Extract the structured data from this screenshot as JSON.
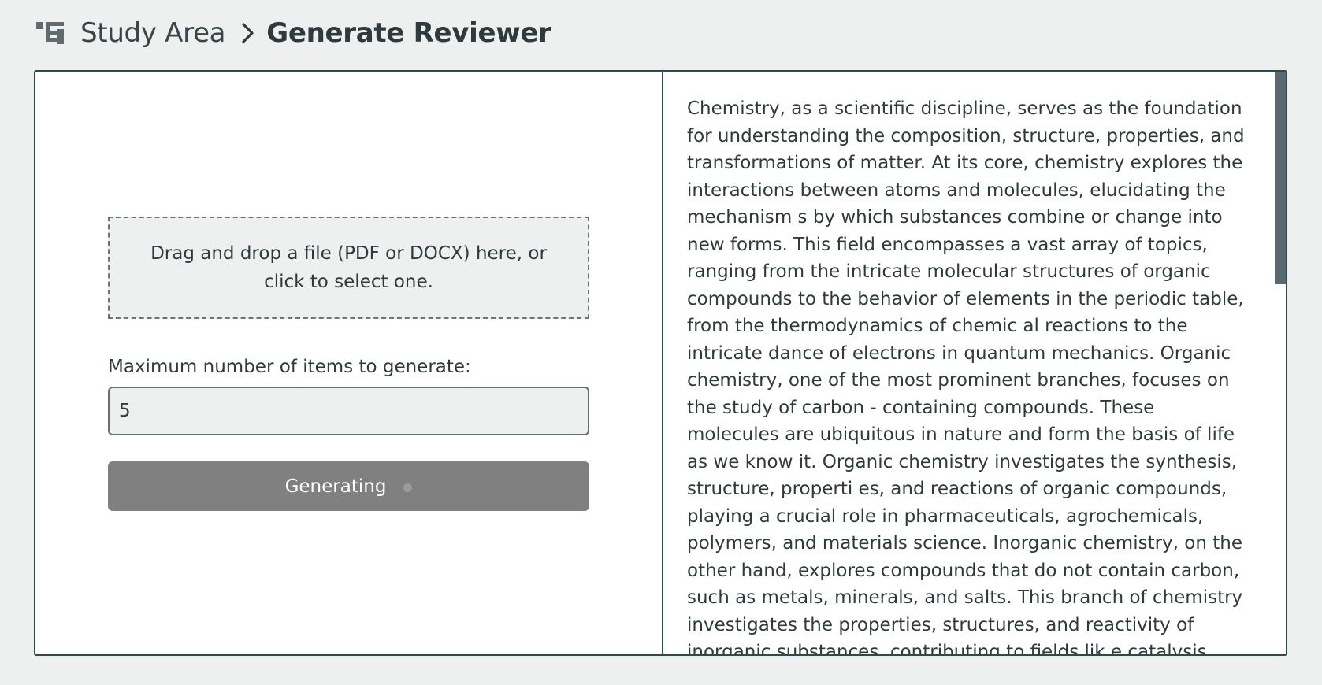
{
  "header": {
    "icon": "hierarchy-icon",
    "parent_label": "Study Area",
    "separator_icon": "chevron-right-icon",
    "current_label": "Generate Reviewer"
  },
  "uploader": {
    "dropzone_text": "Drag and drop a file (PDF or DOCX) here, or click to select one."
  },
  "settings": {
    "max_items_label": "Maximum number of items to generate:",
    "max_items_value": "5"
  },
  "actions": {
    "generate_label": "Generating",
    "state": "loading"
  },
  "preview": {
    "text": "Chemistry, as a scientific discipline, serves as the foundation for understanding the composition,  structure, properties, and transformations of matter. At its core, chemistry explores the interactions  between atoms and molecules, elucidating the mechanism s by which substances combine or change  into new forms. This field encompasses a vast array of topics, ranging from the intricate molecular  structures of organic compounds to the behavior of elements in the periodic table, from the  thermodynamics of chemic al reactions to the intricate dance of electrons in quantum mechanics.  Organic chemistry, one of the most prominent branches, focuses on the study of carbon - containing  compounds. These molecules are ubiquitous in nature and form the basis of life as we know it. Organic  chemistry investigates the synthesis, structure, properti es, and reactions of organic compounds, playing  a crucial role in pharmaceuticals, agrochemicals, polymers, and materials science.  Inorganic chemistry, on the other hand, explores compounds that do not contain carbon, such as metals,  minerals, and salts. This branch of chemistry investigates the properties, structures, and reactivity of inorganic substances, contributing to fields lik e catalysis."
  },
  "colors": {
    "background": "#eef0ef",
    "frame_border": "#2e4b4b",
    "button_disabled": "#808080",
    "text": "#2f3a3d",
    "scrollbar_thumb": "#5a6870"
  }
}
